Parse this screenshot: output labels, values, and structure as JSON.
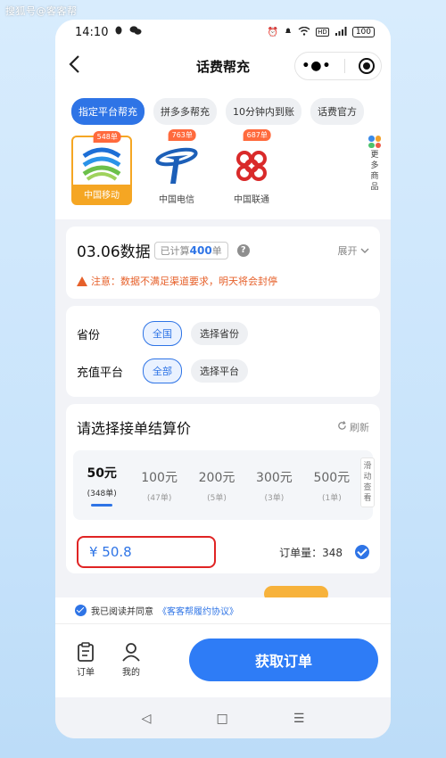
{
  "watermark": "搜狐号@客客帮",
  "status": {
    "time": "14:10",
    "battery": "100"
  },
  "nav": {
    "title": "话费帮充"
  },
  "filters": [
    "指定平台帮充",
    "拼多多帮充",
    "10分钟内到账",
    "话费官方"
  ],
  "carriers": [
    {
      "name": "中国移动",
      "badge": "548单"
    },
    {
      "name": "中国电信",
      "badge": "763单"
    },
    {
      "name": "中国联通",
      "badge": "687单"
    }
  ],
  "more_label": [
    "更",
    "多",
    "商",
    "品"
  ],
  "data_card": {
    "title": "03.06数据",
    "count_prefix": "已计算",
    "count_value": "400",
    "count_suffix": "单",
    "help": "?",
    "expand": "展开",
    "notice": "注意：数据不满足渠道要求，明天将会封停"
  },
  "filter_card": {
    "province_label": "省份",
    "province_options": [
      "全国",
      "选择省份"
    ],
    "platform_label": "充值平台",
    "platform_options": [
      "全部",
      "选择平台"
    ]
  },
  "price_card": {
    "title": "请选择接单结算价",
    "refresh": "刷新",
    "amounts": [
      {
        "value": "50元",
        "count": "(348单)"
      },
      {
        "value": "100元",
        "count": "(47单)"
      },
      {
        "value": "200元",
        "count": "(5单)"
      },
      {
        "value": "300元",
        "count": "(3单)"
      },
      {
        "value": "500元",
        "count": "(1单)"
      }
    ],
    "scroll_hint": [
      "滑",
      "动",
      "查",
      "看"
    ],
    "price": "¥ 50.8",
    "order_qty": "订单量：348"
  },
  "agreement": {
    "prefix": "我已阅读并同意",
    "link": "《客客帮履约协议》"
  },
  "actions": {
    "orders": "订单",
    "mine": "我的",
    "cta": "获取订单"
  },
  "sysnav": {
    "back": "◁",
    "home": "□",
    "menu": "☰"
  },
  "colors": {
    "primary": "#2e74e6",
    "accent": "#f5a623",
    "warning": "#e6602a",
    "highlight": "#e02424"
  }
}
